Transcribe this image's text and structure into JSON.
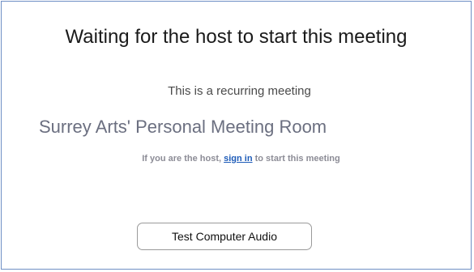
{
  "meeting": {
    "status_title": "Waiting for the host to start this meeting",
    "recurring_text": "This is a recurring meeting",
    "room_name": "Surrey Arts' Personal Meeting Room",
    "host_hint_prefix": "If you are the host, ",
    "sign_in_link": "sign in",
    "host_hint_suffix": " to start this meeting"
  },
  "actions": {
    "test_audio_label": "Test Computer Audio"
  },
  "colors": {
    "link": "#1d5bb8",
    "frame_border": "#6e8fc4",
    "room_name": "#6b6f80"
  }
}
